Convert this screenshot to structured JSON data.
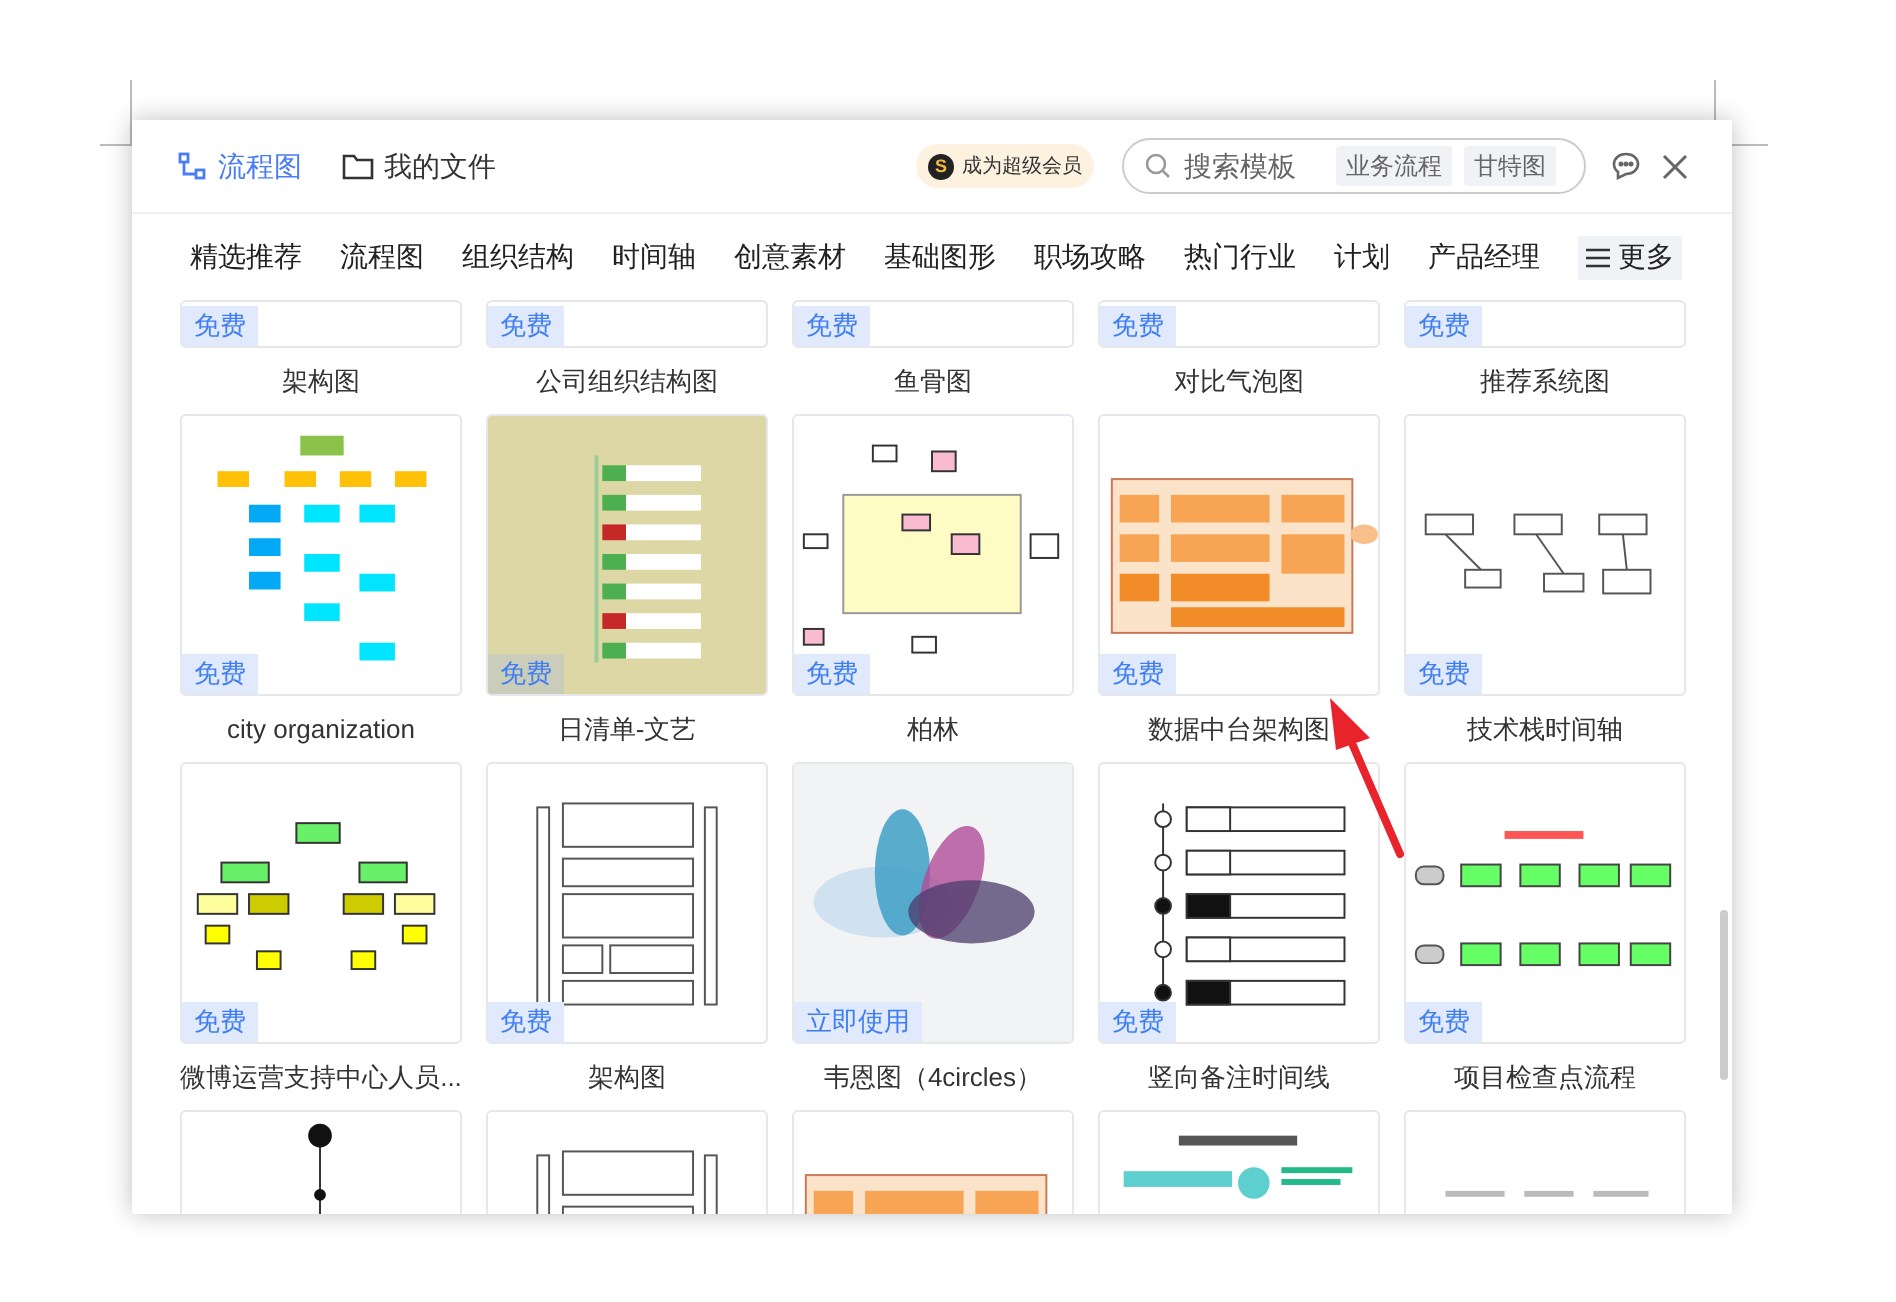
{
  "header": {
    "tabs": [
      {
        "label": "流程图",
        "selected": true
      },
      {
        "label": "我的文件",
        "selected": false
      }
    ],
    "vip": "成为超级会员",
    "vip_icon": "S",
    "search": {
      "placeholder": "搜索模板",
      "tags": [
        "业务流程",
        "甘特图"
      ]
    }
  },
  "categories": [
    "精选推荐",
    "流程图",
    "组织结构",
    "时间轴",
    "创意素材",
    "基础图形",
    "职场攻略",
    "热门行业",
    "计划",
    "产品经理"
  ],
  "more": "更多",
  "rows": [
    {
      "cards": [
        {
          "badge": "免费",
          "title": "架构图"
        },
        {
          "badge": "免费",
          "title": "公司组织结构图"
        },
        {
          "badge": "免费",
          "title": "鱼骨图"
        },
        {
          "badge": "免费",
          "title": "对比气泡图"
        },
        {
          "badge": "免费",
          "title": "推荐系统图"
        }
      ]
    },
    {
      "cards": [
        {
          "badge": "免费",
          "title": "city organization",
          "kind": "org"
        },
        {
          "badge": "免费",
          "title": "日清单-文艺",
          "kind": "list"
        },
        {
          "badge": "免费",
          "title": "柏林",
          "kind": "flow"
        },
        {
          "badge": "免费",
          "title": "数据中台架构图",
          "kind": "arch"
        },
        {
          "badge": "免费",
          "title": "技术栈时间轴",
          "kind": "boxes"
        }
      ]
    },
    {
      "cards": [
        {
          "badge": "免费",
          "title": "微博运营支持中心人员...",
          "kind": "tree"
        },
        {
          "badge": "免费",
          "title": "架构图",
          "kind": "layers"
        },
        {
          "badge": "立即使用",
          "title": "韦恩图（4circles）",
          "kind": "venn"
        },
        {
          "badge": "免费",
          "title": "竖向备注时间线",
          "kind": "timeline"
        },
        {
          "badge": "免费",
          "title": "项目检查点流程",
          "kind": "greenflow"
        }
      ]
    },
    {
      "cards": [
        {
          "kind": "line"
        },
        {
          "kind": "layers"
        },
        {
          "kind": "arch"
        },
        {
          "kind": "doc"
        },
        {
          "kind": "sketch"
        }
      ]
    }
  ]
}
